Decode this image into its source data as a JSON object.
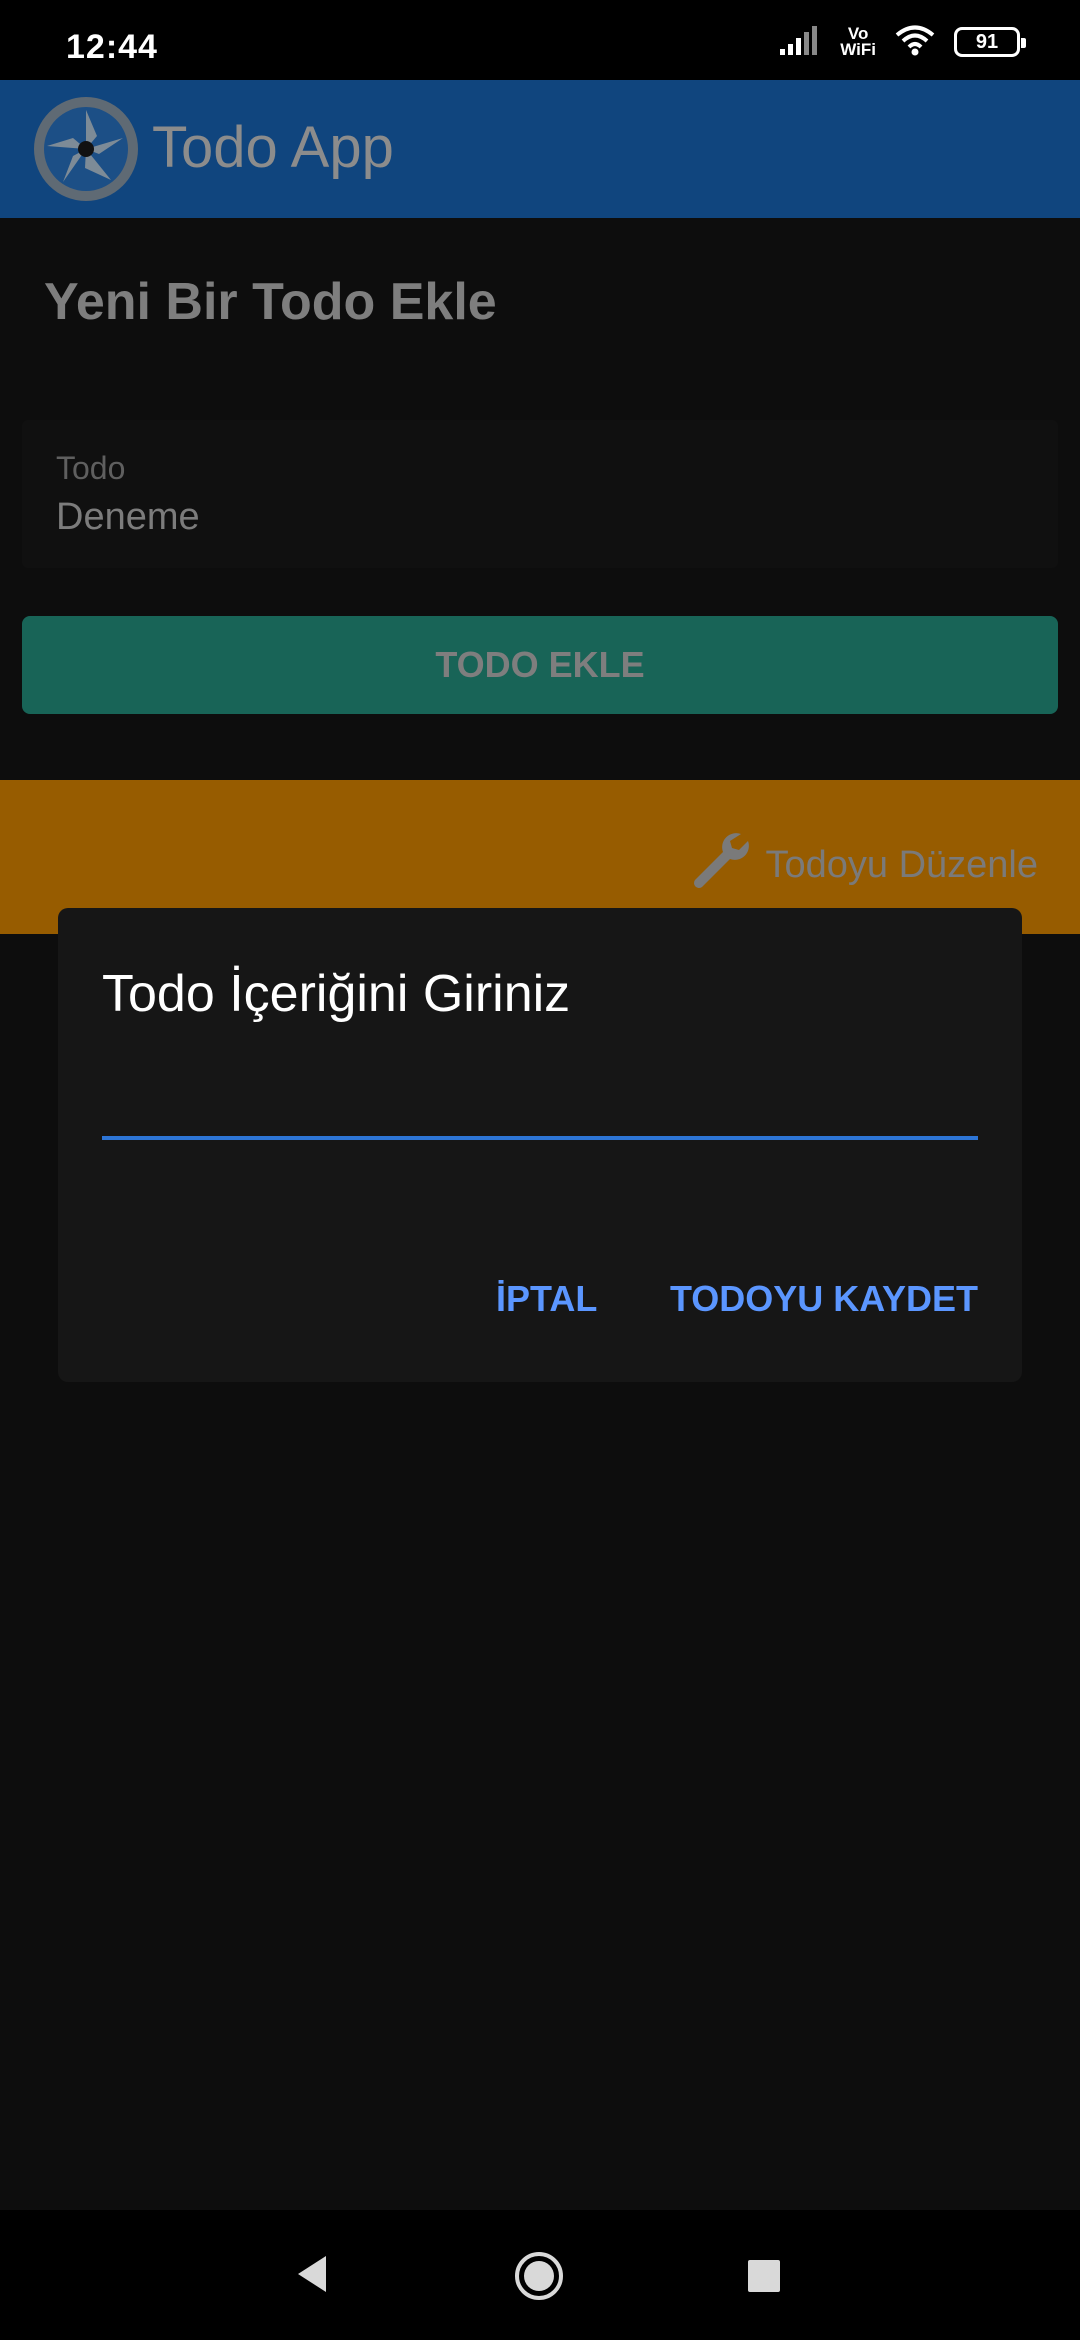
{
  "status_bar": {
    "time": "12:44",
    "vowifi_top": "Vo",
    "vowifi_bottom": "WiFi",
    "battery": "91",
    "icons": [
      "signal-icon",
      "vowifi-icon",
      "wifi-icon",
      "battery-icon"
    ]
  },
  "app_bar": {
    "title": "Todo App",
    "logo_icon": "app-logo-icon"
  },
  "main": {
    "section_title": "Yeni Bir Todo Ekle",
    "todo_label": "Todo",
    "todo_value": "Deneme",
    "add_button_label": "TODO EKLE",
    "edit_label": "Todoyu Düzenle",
    "edit_icon": "wrench-icon"
  },
  "dialog": {
    "title": "Todo İçeriğini Giriniz",
    "input_value": "",
    "cancel_label": "İPTAL",
    "save_label": "TODOYU KAYDET"
  },
  "nav_bar": {
    "icons": [
      "back-icon",
      "home-icon",
      "recents-icon"
    ]
  },
  "colors": {
    "app_bar": "#10457e",
    "add_button": "#186457",
    "edit_bar": "#975c00",
    "dialog_accent": "#5b96ff",
    "input_underline": "#2d75d6"
  }
}
